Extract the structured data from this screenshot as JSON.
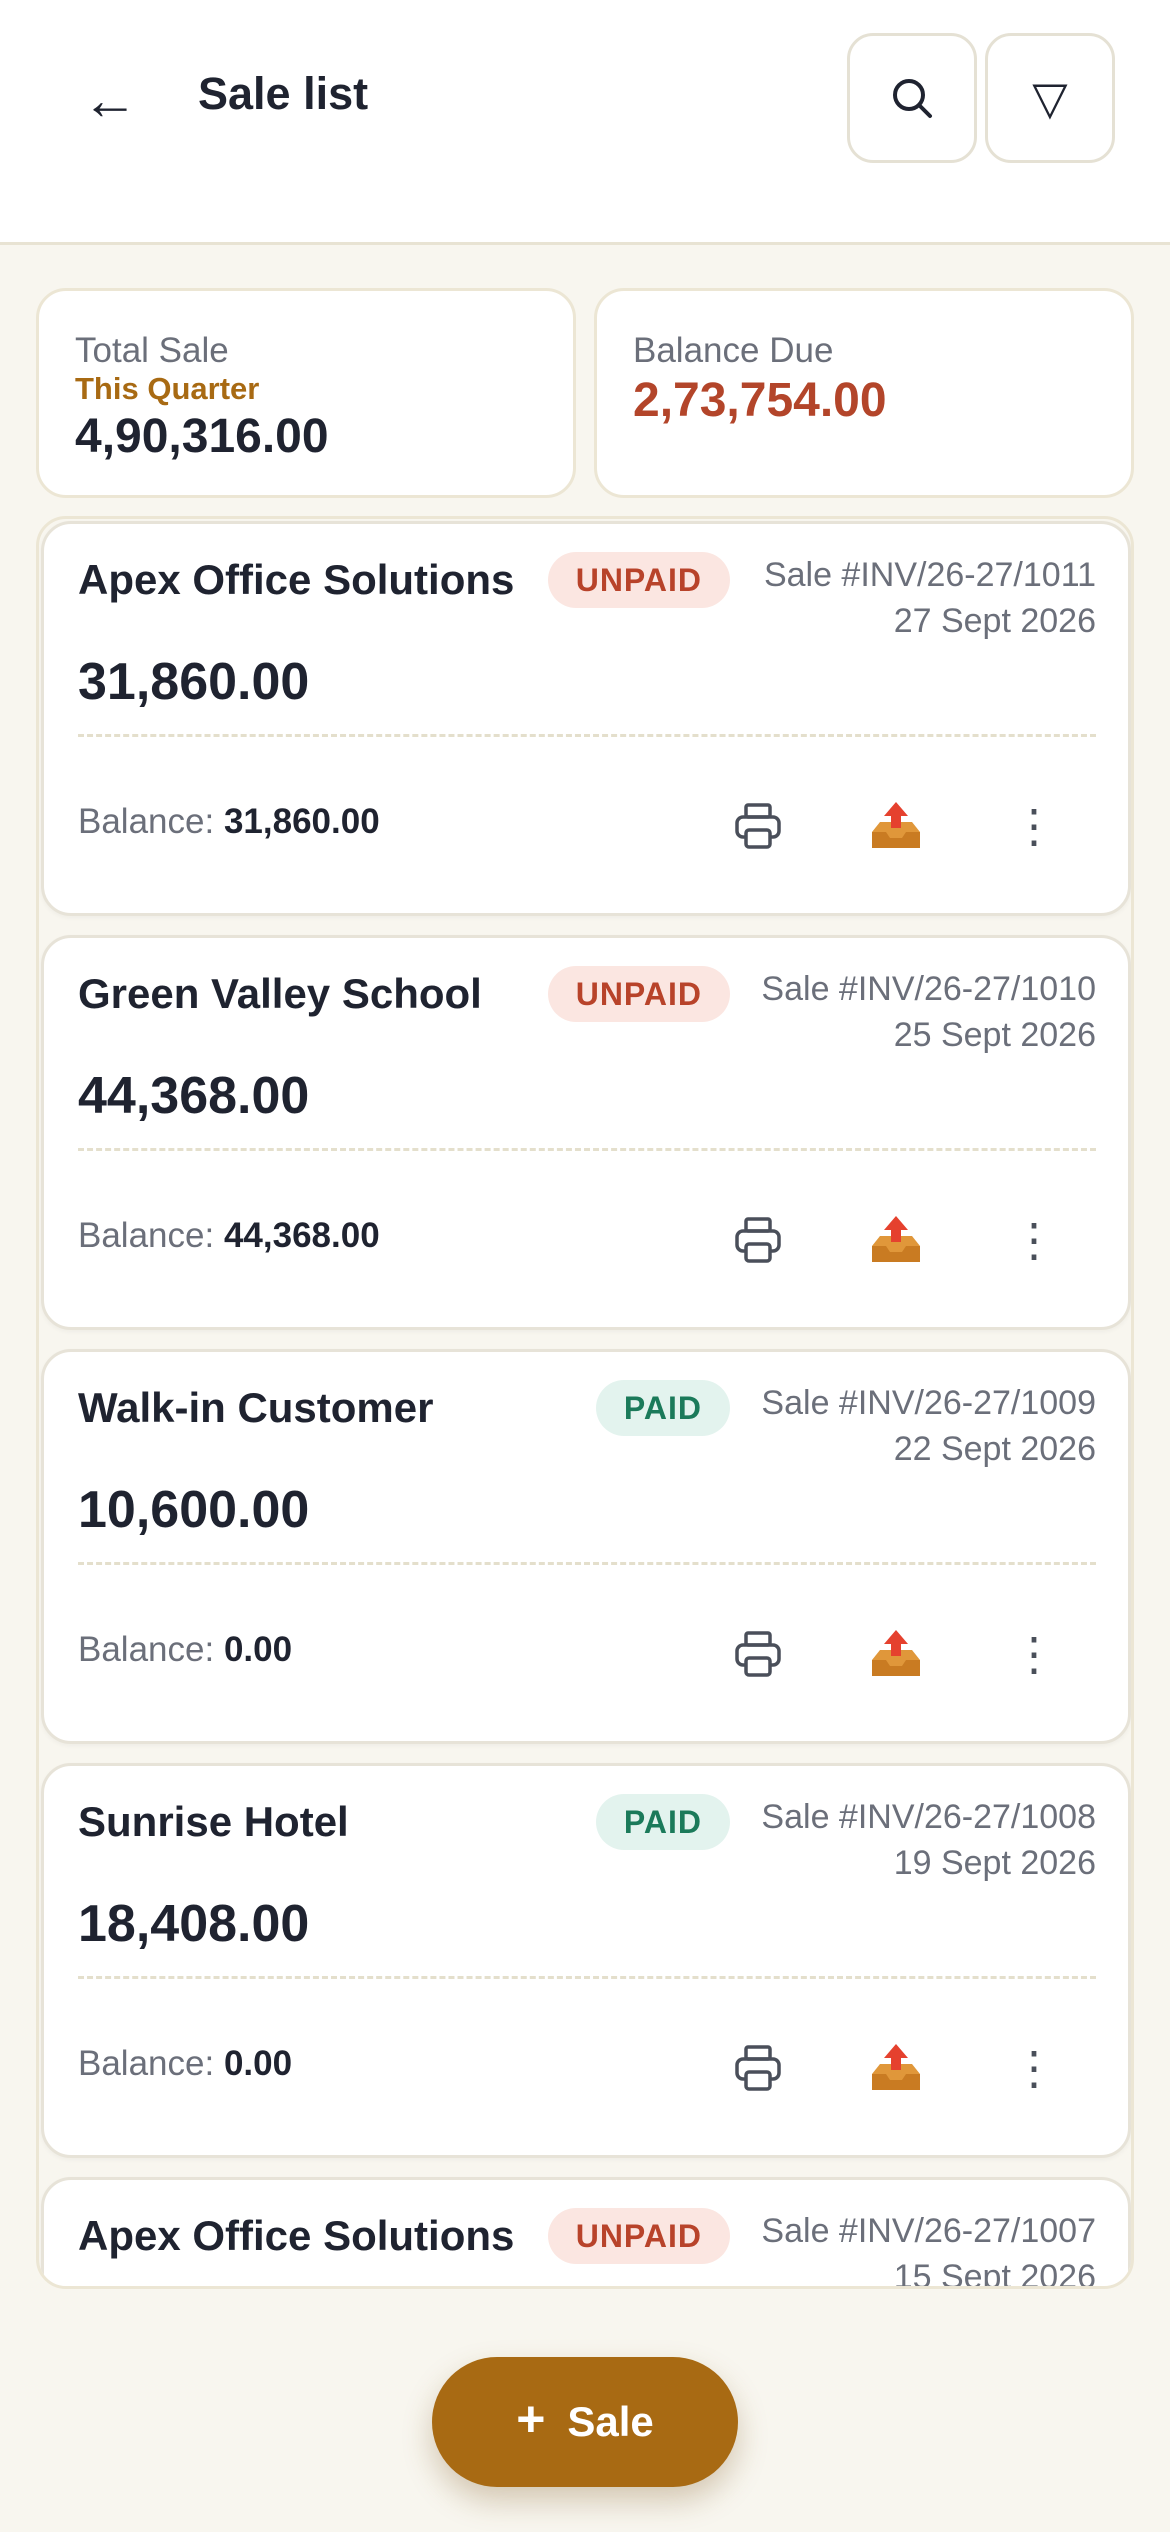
{
  "header": {
    "title": "Sale list",
    "back_icon": "←",
    "filter_icon": "▽"
  },
  "summary": {
    "total_label": "Total Sale",
    "period": "This Quarter",
    "total_value": "4,90,316.00",
    "due_label": "Balance Due",
    "due_value": "2,73,754.00"
  },
  "sales": [
    {
      "customer": "Apex Office Solutions",
      "status": "UNPAID",
      "invoice": "Sale #INV/26-27/1011",
      "date": "27 Sept 2026",
      "amount": "31,860.00",
      "balance_label": "Balance:",
      "balance": "31,860.00"
    },
    {
      "customer": "Green Valley School",
      "status": "UNPAID",
      "invoice": "Sale #INV/26-27/1010",
      "date": "25 Sept 2026",
      "amount": "44,368.00",
      "balance_label": "Balance:",
      "balance": "44,368.00"
    },
    {
      "customer": "Walk-in Customer",
      "status": "PAID",
      "invoice": "Sale #INV/26-27/1009",
      "date": "22 Sept 2026",
      "amount": "10,600.00",
      "balance_label": "Balance:",
      "balance": "0.00"
    },
    {
      "customer": "Sunrise Hotel",
      "status": "PAID",
      "invoice": "Sale #INV/26-27/1008",
      "date": "19 Sept 2026",
      "amount": "18,408.00",
      "balance_label": "Balance:",
      "balance": "0.00"
    },
    {
      "customer": "Apex Office Solutions",
      "status": "UNPAID",
      "invoice": "Sale #INV/26-27/1007",
      "date": "15 Sept 2026",
      "amount": "",
      "balance_label": "",
      "balance": ""
    }
  ],
  "fab": {
    "plus": "+",
    "label": "Sale"
  },
  "icons": {
    "back": "arrow-left-icon",
    "search": "search-icon",
    "filter": "filter-icon",
    "print": "printer-icon",
    "share": "outbox-tray-icon",
    "more": "more-vertical-icon"
  },
  "colors": {
    "accent": "#a86a13",
    "unpaid_text": "#b8432a",
    "unpaid_bg": "#fbe6e1",
    "paid_text": "#1b7a5a",
    "paid_bg": "#e3f3ee",
    "balance_due": "#b3452a"
  }
}
